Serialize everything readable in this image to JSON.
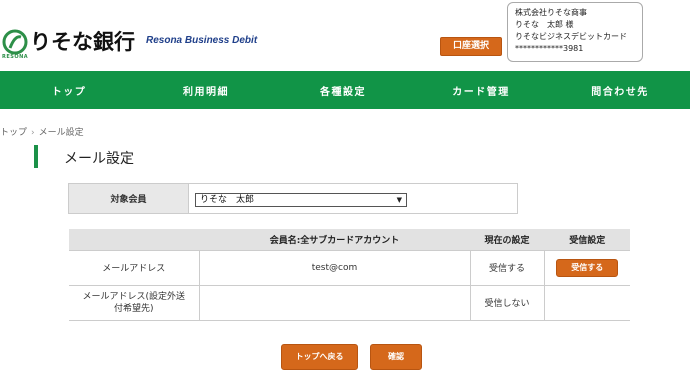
{
  "brand": {
    "name": "りそな銀行",
    "logo_sub": "RESONA",
    "subtitle": "Resona Business Debit"
  },
  "header": {
    "account_select_label": "口座選択",
    "user_info": {
      "company": "株式会社りそな商事",
      "user": "りそな　太郎 様",
      "card_name": "りそなビジネスデビットカード",
      "card_number": "************3981"
    }
  },
  "nav": {
    "items": [
      "トップ",
      "利用明細",
      "各種設定",
      "カード管理",
      "問合わせ先"
    ]
  },
  "breadcrumb": {
    "home": "トップ",
    "separator": "›",
    "current": "メール設定"
  },
  "page_title": "メール設定",
  "member": {
    "label": "対象会員",
    "selected": "りそな　太郎"
  },
  "mail_table": {
    "headers": [
      "",
      "会員名:全サブカードアカウント",
      "現在の設定",
      "受信設定"
    ],
    "rows": [
      {
        "label": "メールアドレス",
        "value": "test@com",
        "status": "受信する",
        "action": "受信する"
      },
      {
        "label_line1": "メールアドレス(設定外送",
        "label_line2": "付希望先)",
        "value": "",
        "status": "受信しない",
        "action": ""
      }
    ]
  },
  "buttons": {
    "back_top": "トップへ戻る",
    "confirm": "確認"
  },
  "colors": {
    "brand_green": "#119447",
    "action_orange": "#d5681b"
  }
}
